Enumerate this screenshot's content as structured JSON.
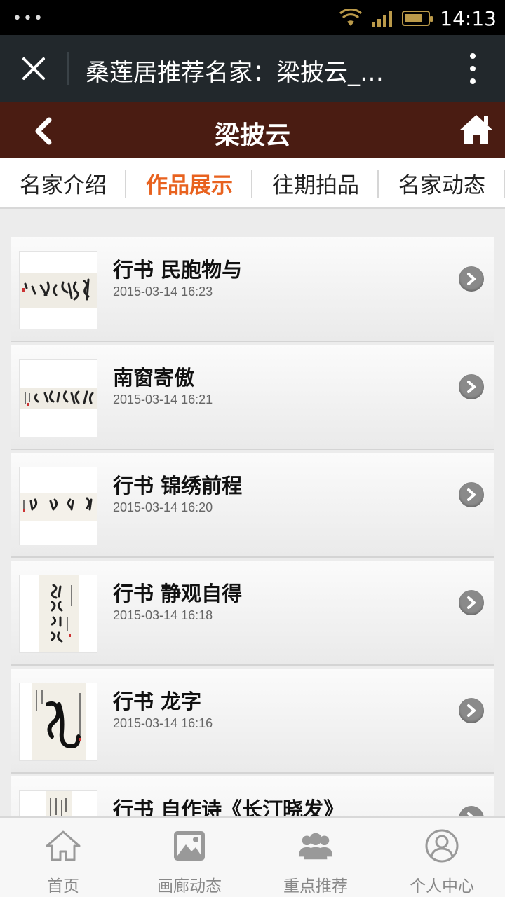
{
  "status_bar": {
    "time": "14:13"
  },
  "title_bar": {
    "title": "桑莲居推荐名家：梁披云_…"
  },
  "header": {
    "title": "梁披云"
  },
  "tabs": [
    {
      "label": "名家介绍",
      "active": false
    },
    {
      "label": "作品展示",
      "active": true
    },
    {
      "label": "往期拍品",
      "active": false
    },
    {
      "label": "名家动态",
      "active": false
    }
  ],
  "works": [
    {
      "title": "行书 民胞物与",
      "date": "2015-03-14 16:23"
    },
    {
      "title": "南窗寄傲",
      "date": "2015-03-14 16:21"
    },
    {
      "title": "行书 锦绣前程",
      "date": "2015-03-14 16:20"
    },
    {
      "title": "行书 静观自得",
      "date": "2015-03-14 16:18"
    },
    {
      "title": "行书 龙字",
      "date": "2015-03-14 16:16"
    },
    {
      "title": "行书 自作诗《长汀晓发》",
      "date": ""
    }
  ],
  "bottom_nav": [
    {
      "label": "首页",
      "icon": "home-outline-icon"
    },
    {
      "label": "画廊动态",
      "icon": "gallery-image-icon"
    },
    {
      "label": "重点推荐",
      "icon": "group-users-icon"
    },
    {
      "label": "个人中心",
      "icon": "user-profile-icon"
    }
  ],
  "colors": {
    "header_bg": "#4a1c12",
    "title_bar_bg": "#22282c",
    "active_tab": "#e8621f"
  }
}
